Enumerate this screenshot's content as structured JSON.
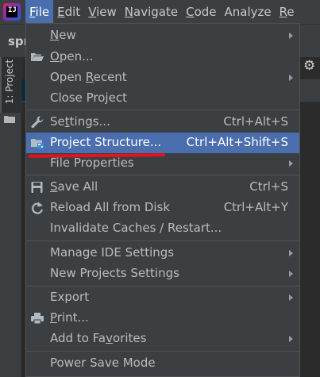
{
  "menubar": {
    "logo_text": "IJ",
    "items": [
      {
        "mnemonic": "F",
        "rest": "ile"
      },
      {
        "mnemonic": "E",
        "rest": "dit"
      },
      {
        "mnemonic": "V",
        "rest": "iew"
      },
      {
        "mnemonic": "N",
        "rest": "avigate"
      },
      {
        "mnemonic": "C",
        "rest": "ode"
      },
      {
        "mnemonic": "",
        "rest": "Analyze"
      },
      {
        "mnemonic": "R",
        "rest": "e"
      }
    ]
  },
  "window": {
    "breadcrumb": "spr",
    "tool_tab": "1: Project"
  },
  "file_menu": {
    "items": [
      {
        "pre": "",
        "mn": "N",
        "post": "ew",
        "shortcut": ""
      },
      {
        "pre": "",
        "mn": "O",
        "post": "pen...",
        "shortcut": ""
      },
      {
        "pre": "Open ",
        "mn": "R",
        "post": "ecent",
        "shortcut": ""
      },
      {
        "pre": "Close Project",
        "mn": "",
        "post": "",
        "shortcut": ""
      },
      {
        "pre": "Se",
        "mn": "t",
        "post": "tings...",
        "shortcut": "Ctrl+Alt+S"
      },
      {
        "pre": "Project Structure...",
        "mn": "",
        "post": "",
        "shortcut": "Ctrl+Alt+Shift+S"
      },
      {
        "pre": "File Properties",
        "mn": "",
        "post": "",
        "shortcut": ""
      },
      {
        "pre": "",
        "mn": "S",
        "post": "ave All",
        "shortcut": "Ctrl+S"
      },
      {
        "pre": "Reload All from Disk",
        "mn": "",
        "post": "",
        "shortcut": "Ctrl+Alt+Y"
      },
      {
        "pre": "Invalidate Caches / Restart...",
        "mn": "",
        "post": "",
        "shortcut": ""
      },
      {
        "pre": "Manage IDE Settings",
        "mn": "",
        "post": "",
        "shortcut": ""
      },
      {
        "pre": "New Projects Settings",
        "mn": "",
        "post": "",
        "shortcut": ""
      },
      {
        "pre": "Export",
        "mn": "",
        "post": "",
        "shortcut": ""
      },
      {
        "pre": "",
        "mn": "P",
        "post": "rint...",
        "shortcut": ""
      },
      {
        "pre": "Add to Fa",
        "mn": "v",
        "post": "orites",
        "shortcut": ""
      },
      {
        "pre": "Power Save Mode",
        "mn": "",
        "post": "",
        "shortcut": ""
      }
    ]
  },
  "colors": {
    "selection": "#4b6eaf",
    "annotation": "#e5141c",
    "menu_bg": "#3c3f41"
  }
}
